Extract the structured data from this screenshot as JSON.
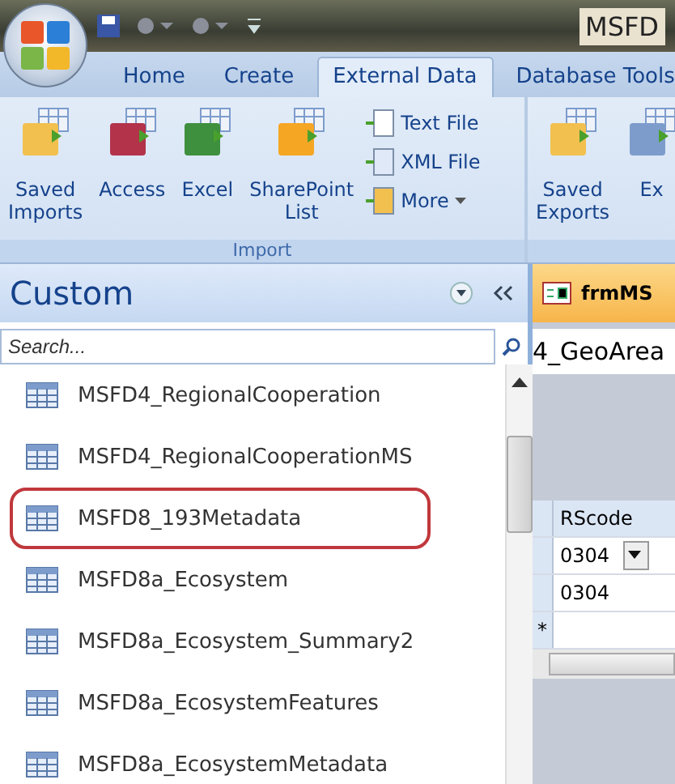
{
  "window": {
    "title": "MSFD"
  },
  "tabs": [
    {
      "label": "Home",
      "selected": false
    },
    {
      "label": "Create",
      "selected": false
    },
    {
      "label": "External Data",
      "selected": true
    },
    {
      "label": "Database Tools",
      "selected": false
    }
  ],
  "ribbon": {
    "groups": [
      {
        "label": "Import",
        "buttons": [
          {
            "kind": "large",
            "lines": [
              "Saved",
              "Imports"
            ]
          },
          {
            "kind": "large",
            "lines": [
              "Access"
            ]
          },
          {
            "kind": "large",
            "lines": [
              "Excel"
            ]
          },
          {
            "kind": "large",
            "lines": [
              "SharePoint",
              "List"
            ]
          },
          {
            "kind": "small",
            "lines": [
              "Text File"
            ],
            "dropdown": false
          },
          {
            "kind": "small",
            "lines": [
              "XML File"
            ],
            "dropdown": false
          },
          {
            "kind": "small",
            "lines": [
              "More"
            ],
            "dropdown": true
          }
        ]
      },
      {
        "buttons": [
          {
            "kind": "large",
            "lines": [
              "Saved",
              "Exports"
            ]
          },
          {
            "kind": "large",
            "lines": [
              "Ex"
            ]
          }
        ]
      }
    ]
  },
  "nav_pane": {
    "title": "Custom",
    "search": {
      "placeholder": "Search..."
    },
    "items": [
      {
        "label": "MSFD4_RegionalCooperation",
        "circled": false
      },
      {
        "label": "MSFD4_RegionalCooperationMS",
        "circled": false
      },
      {
        "label": "MSFD8_193Metadata",
        "circled": true
      },
      {
        "label": "MSFD8a_Ecosystem",
        "circled": false
      },
      {
        "label": "MSFD8a_Ecosystem_Summary2",
        "circled": false
      },
      {
        "label": "MSFD8a_EcosystemFeatures",
        "circled": false
      },
      {
        "label": "MSFD8a_EcosystemMetadata",
        "circled": false
      }
    ]
  },
  "document": {
    "tab": "frmMS",
    "caption": "4_GeoArea",
    "datasheet": {
      "columns": [
        "RScode"
      ],
      "rows": [
        {
          "value": "0304",
          "dropdown": true
        },
        {
          "value": "0304",
          "dropdown": false
        }
      ],
      "new_row_marker": "*"
    }
  }
}
